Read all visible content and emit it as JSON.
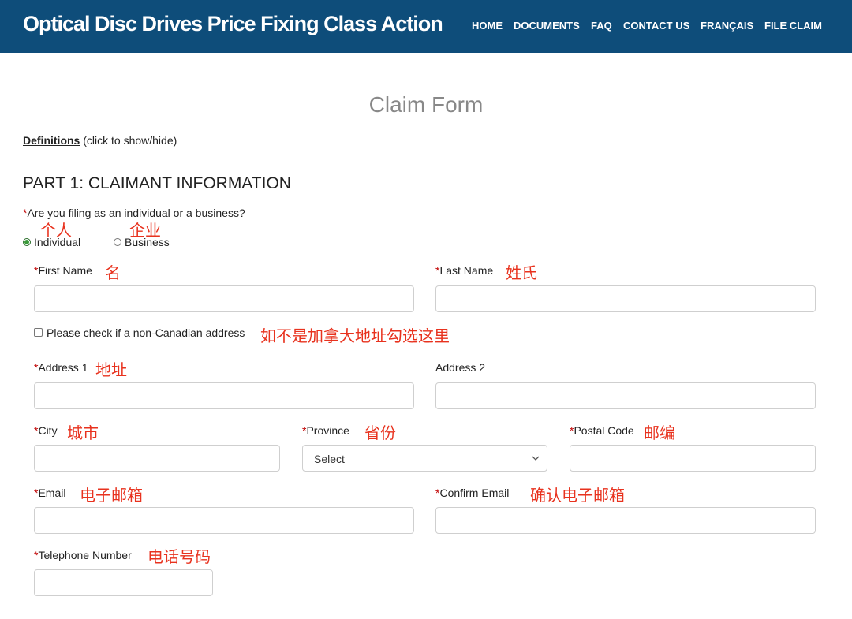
{
  "header": {
    "site_title": "Optical Disc Drives Price Fixing Class Action",
    "nav": [
      "HOME",
      "DOCUMENTS",
      "FAQ",
      "CONTACT US",
      "FRANÇAIS",
      "FILE CLAIM"
    ]
  },
  "page": {
    "heading": "Claim Form",
    "definitions_link": "Definitions",
    "definitions_hint": "(click to show/hide)",
    "part_heading": "PART 1: CLAIMANT INFORMATION"
  },
  "filing_type": {
    "question": "Are you filing as an individual or a business?",
    "options": [
      "Individual",
      "Business"
    ],
    "selected": "Individual",
    "annotations": [
      "个人",
      "企业"
    ]
  },
  "fields": {
    "required_marker": "*",
    "first_name": {
      "label": "First Name",
      "annotation": "名",
      "value": ""
    },
    "last_name": {
      "label": "Last Name",
      "annotation": "姓氏",
      "value": ""
    },
    "non_canadian": {
      "label": "Please check if a non-Canadian address",
      "annotation": "如不是加拿大地址勾选这里",
      "checked": false
    },
    "address1": {
      "label": "Address 1",
      "annotation": "地址",
      "value": ""
    },
    "address2": {
      "label": "Address 2",
      "value": ""
    },
    "city": {
      "label": "City",
      "annotation": "城市",
      "value": ""
    },
    "province": {
      "label": "Province",
      "annotation": "省份",
      "selected": "Select"
    },
    "postal_code": {
      "label": "Postal Code",
      "annotation": "邮编",
      "value": ""
    },
    "email": {
      "label": "Email",
      "annotation": "电子邮箱",
      "value": ""
    },
    "confirm_email": {
      "label": "Confirm Email",
      "annotation": "确认电子邮箱",
      "value": ""
    },
    "telephone": {
      "label": "Telephone Number",
      "annotation": "电话号码",
      "value": ""
    }
  },
  "colors": {
    "header_bg": "#0e4d7a",
    "annotation": "#e8321e",
    "required": "#c00000",
    "heading_grey": "#888888"
  }
}
